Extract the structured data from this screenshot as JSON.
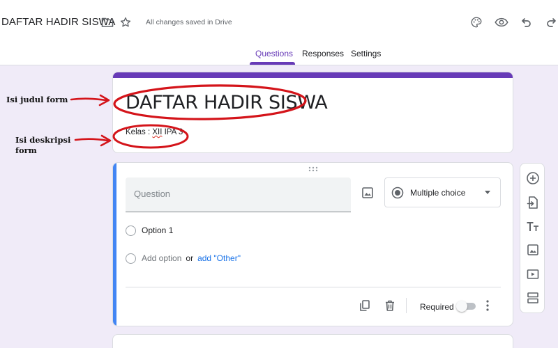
{
  "header": {
    "doc_title": "DAFTAR HADIR SISWA",
    "saved_status": "All changes saved in Drive",
    "icons": [
      "folder-icon",
      "star-icon",
      "palette-icon",
      "eye-icon",
      "undo-icon",
      "redo-icon"
    ]
  },
  "tabs": [
    {
      "label": "Questions",
      "active": true
    },
    {
      "label": "Responses",
      "active": false
    },
    {
      "label": "Settings",
      "active": false
    }
  ],
  "form": {
    "title": "DAFTAR HADIR SISWA",
    "description_prefix": "Kelas : ",
    "description_flagged": "XII",
    "description_suffix": " IPA 3"
  },
  "annotations": {
    "title_note": "Isi judul form",
    "desc_note_line1": "Isi deskripsi",
    "desc_note_line2": "form"
  },
  "question_card": {
    "question_placeholder": "Question",
    "question_type": "Multiple choice",
    "options": [
      "Option 1"
    ],
    "add_option": "Add option",
    "or_text": "or",
    "add_other": "add \"Other\"",
    "required_label": "Required",
    "required": false
  },
  "colors": {
    "accent": "#673ab7",
    "active_card_bar": "#4285f4",
    "background": "#f0ebf8",
    "annotation_red": "#d4141a",
    "link": "#1a73e8"
  },
  "toolbar": [
    "add-question-icon",
    "import-questions-icon",
    "add-title-icon",
    "add-image-icon",
    "add-video-icon",
    "add-section-icon"
  ]
}
